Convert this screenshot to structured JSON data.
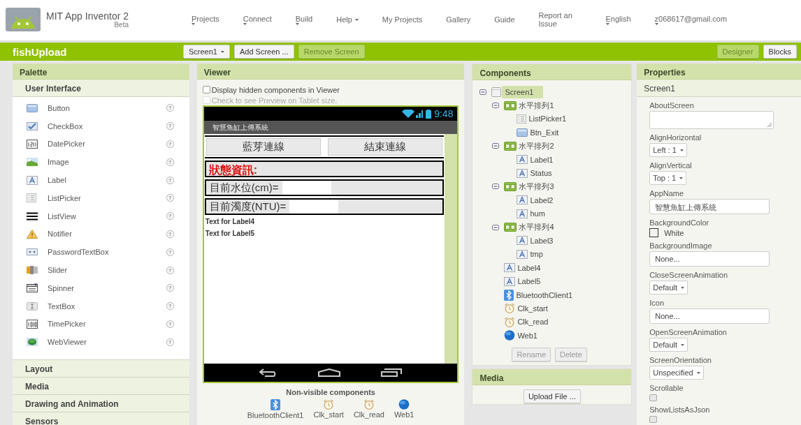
{
  "header": {
    "title": "MIT App Inventor 2",
    "subtitle": "Beta",
    "menu": [
      {
        "label": "Projects",
        "kind": "dropdown"
      },
      {
        "label": "Connect",
        "kind": "dropdown"
      },
      {
        "label": "Build",
        "kind": "dropdown"
      },
      {
        "label": "Help",
        "kind": "inline"
      },
      {
        "label": "My Projects",
        "kind": "link"
      },
      {
        "label": "Gallery",
        "kind": "link"
      },
      {
        "label": "Guide",
        "kind": "link"
      },
      {
        "label": "Report an Issue",
        "kind": "link"
      },
      {
        "label": "English",
        "kind": "dropdown"
      },
      {
        "label": "z068617@gmail.com",
        "kind": "dropdown"
      }
    ]
  },
  "project_bar": {
    "project_name": "fishUpload",
    "screen_select": "Screen1",
    "buttons": [
      {
        "label": "Add Screen ...",
        "disabled": false
      },
      {
        "label": "Remove Screen",
        "disabled": true
      }
    ],
    "views": [
      {
        "label": "Designer",
        "selected": true
      },
      {
        "label": "Blocks",
        "selected": false
      }
    ]
  },
  "palette": {
    "title": "Palette",
    "sections": [
      {
        "label": "User Interface",
        "items": [
          {
            "name": "Button",
            "kind": "button",
            "help": "?"
          },
          {
            "name": "CheckBox",
            "kind": "checkbox",
            "help": "?"
          },
          {
            "name": "DatePicker",
            "kind": "datepicker",
            "help": "?"
          },
          {
            "name": "Image",
            "kind": "image",
            "help": "?"
          },
          {
            "name": "Label",
            "kind": "label",
            "help": "?"
          },
          {
            "name": "ListPicker",
            "kind": "listpicker",
            "help": "?"
          },
          {
            "name": "ListView",
            "kind": "listview",
            "help": "?"
          },
          {
            "name": "Notifier",
            "kind": "notifier",
            "help": "?"
          },
          {
            "name": "PasswordTextBox",
            "kind": "password",
            "help": "?"
          },
          {
            "name": "Slider",
            "kind": "slider",
            "help": "?"
          },
          {
            "name": "Spinner",
            "kind": "spinner",
            "help": "?"
          },
          {
            "name": "TextBox",
            "kind": "textbox",
            "help": "?"
          },
          {
            "name": "TimePicker",
            "kind": "timepicker",
            "help": "?"
          },
          {
            "name": "WebViewer",
            "kind": "webviewer",
            "help": "?"
          }
        ]
      },
      {
        "label": "Layout"
      },
      {
        "label": "Media"
      },
      {
        "label": "Drawing and Animation"
      },
      {
        "label": "Sensors"
      }
    ]
  },
  "viewer": {
    "title": "Viewer",
    "options": [
      {
        "label": "Display hidden components in Viewer",
        "checked": false,
        "disabled": false
      },
      {
        "label": "Check to see Preview on Tablet size.",
        "checked": false,
        "disabled": true
      }
    ],
    "phone": {
      "time": "9:48",
      "app_title": "智慧魚缸上傳系統",
      "rows": [
        {
          "kind": "buttons",
          "buttons": [
            "藍芽連線",
            "結束連線"
          ]
        },
        {
          "kind": "status",
          "text": "狀態資訊:"
        },
        {
          "kind": "reading",
          "text": "目前水位(cm)="
        },
        {
          "kind": "reading",
          "text": "目前濁度(NTU)="
        },
        {
          "kind": "text",
          "text": "Text for Label4"
        },
        {
          "kind": "text",
          "text": "Text for Label5"
        }
      ]
    },
    "non_visible": {
      "title": "Non-visible components",
      "items": [
        {
          "name": "BluetoothClient1",
          "kind": "bluetooth"
        },
        {
          "name": "Clk_start",
          "kind": "clock"
        },
        {
          "name": "Clk_read",
          "kind": "clock"
        },
        {
          "name": "Web1",
          "kind": "web"
        }
      ]
    }
  },
  "components": {
    "title": "Components",
    "tree": [
      {
        "name": "Screen1",
        "kind": "screen",
        "selected": true,
        "expanded": true,
        "children": [
          {
            "name": "水平排列1",
            "kind": "arrangement",
            "selected": false,
            "expanded": true,
            "children": [
              {
                "name": "ListPicker1",
                "kind": "listpicker",
                "selected": false
              },
              {
                "name": "Btn_Exit",
                "kind": "button",
                "selected": false
              }
            ]
          },
          {
            "name": "水平排列2",
            "kind": "arrangement",
            "selected": false,
            "expanded": true,
            "children": [
              {
                "name": "Label1",
                "kind": "label",
                "selected": false
              },
              {
                "name": "Status",
                "kind": "label",
                "selected": false
              }
            ]
          },
          {
            "name": "水平排列3",
            "kind": "arrangement",
            "selected": false,
            "expanded": true,
            "children": [
              {
                "name": "Label2",
                "kind": "label",
                "selected": false
              },
              {
                "name": "hum",
                "kind": "label",
                "selected": false
              }
            ]
          },
          {
            "name": "水平排列4",
            "kind": "arrangement",
            "selected": false,
            "expanded": true,
            "children": [
              {
                "name": "Label3",
                "kind": "label",
                "selected": false
              },
              {
                "name": "tmp",
                "kind": "label",
                "selected": false
              }
            ]
          },
          {
            "name": "Label4",
            "kind": "label",
            "selected": false
          },
          {
            "name": "Label5",
            "kind": "label",
            "selected": false
          },
          {
            "name": "BluetoothClient1",
            "kind": "bluetooth",
            "selected": false
          },
          {
            "name": "Clk_start",
            "kind": "clock",
            "selected": false
          },
          {
            "name": "Clk_read",
            "kind": "clock",
            "selected": false
          },
          {
            "name": "Web1",
            "kind": "web",
            "selected": false
          }
        ]
      }
    ],
    "buttons": [
      {
        "label": "Rename",
        "disabled": true
      },
      {
        "label": "Delete",
        "disabled": true
      }
    ]
  },
  "media": {
    "title": "Media",
    "button": "Upload File ..."
  },
  "properties": {
    "title": "Properties",
    "subject": "Screen1",
    "items": [
      {
        "name": "AboutScreen",
        "kind": "textarea"
      },
      {
        "name": "AlignHorizontal",
        "kind": "dropdown",
        "value": "Left : 1"
      },
      {
        "name": "AlignVertical",
        "kind": "dropdown",
        "value": "Top : 1"
      },
      {
        "name": "AppName",
        "kind": "textbox",
        "value": "智慧魚缸上傳系統"
      },
      {
        "name": "BackgroundColor",
        "kind": "color",
        "value": "White"
      },
      {
        "name": "BackgroundImage",
        "kind": "asset",
        "value": "None..."
      },
      {
        "name": "CloseScreenAnimation",
        "kind": "dropdown",
        "value": "Default"
      },
      {
        "name": "Icon",
        "kind": "asset",
        "value": "None..."
      },
      {
        "name": "OpenScreenAnimation",
        "kind": "dropdown",
        "value": "Default"
      },
      {
        "name": "ScreenOrientation",
        "kind": "dropdown",
        "value": "Unspecified"
      },
      {
        "name": "Scrollable",
        "kind": "checkbox",
        "checked": false
      },
      {
        "name": "ShowListsAsJson",
        "kind": "checkbox",
        "checked": false
      }
    ]
  }
}
